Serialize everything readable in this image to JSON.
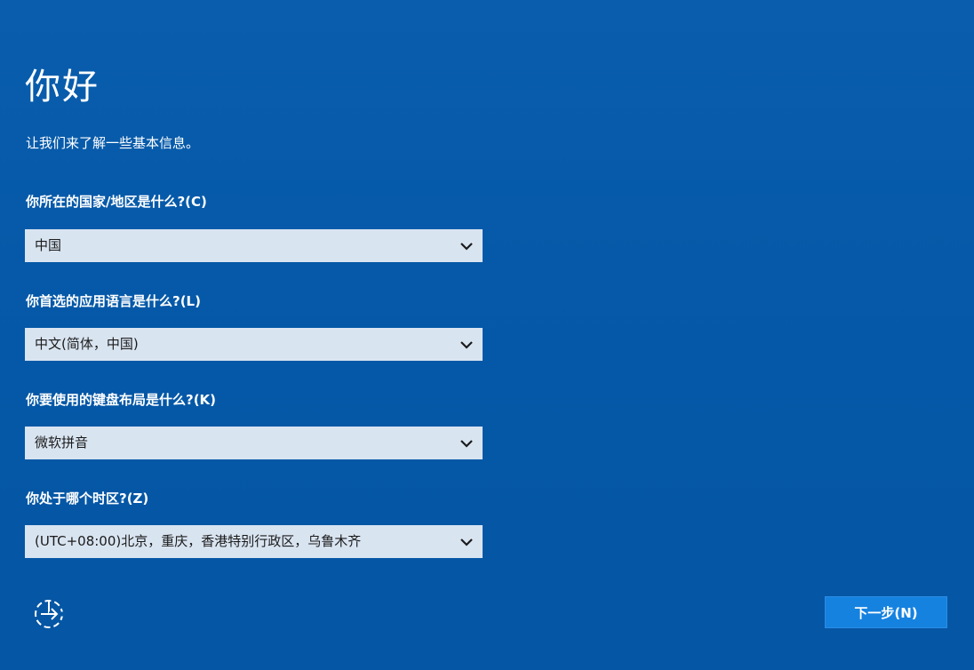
{
  "header": {
    "title": "你好",
    "subtitle": "让我们来了解一些基本信息。"
  },
  "form": {
    "country": {
      "label": "你所在的国家/地区是什么?(C)",
      "value": "中国"
    },
    "app_language": {
      "label": "你首选的应用语言是什么?(L)",
      "value": "中文(简体，中国)"
    },
    "keyboard": {
      "label": "你要使用的键盘布局是什么?(K)",
      "value": "微软拼音"
    },
    "timezone": {
      "label": "你处于哪个时区?(Z)",
      "value": "(UTC+08:00)北京，重庆，香港特别行政区，乌鲁木齐"
    }
  },
  "footer": {
    "accessibility_icon": "ease-of-access-icon",
    "next_label": "下一步(N)"
  },
  "colors": {
    "background": "#0559a8",
    "dropdown": "#d9e4f1",
    "button": "#1582e0"
  }
}
